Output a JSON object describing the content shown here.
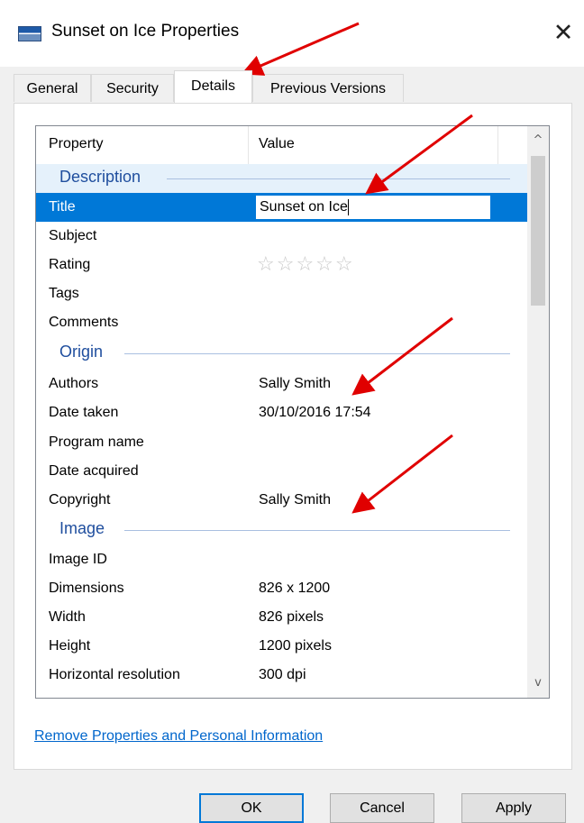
{
  "window": {
    "title": "Sunset on Ice Properties",
    "close_glyph": "✕",
    "icon": "image-file-icon"
  },
  "tabs": [
    {
      "label": "General",
      "active": false
    },
    {
      "label": "Security",
      "active": false
    },
    {
      "label": "Details",
      "active": true
    },
    {
      "label": "Previous Versions",
      "active": false
    }
  ],
  "list": {
    "columns": {
      "property": "Property",
      "value": "Value"
    },
    "groups": {
      "description": "Description",
      "origin": "Origin",
      "image": "Image"
    },
    "rows": {
      "title": {
        "key": "Title",
        "value": "Sunset on Ice"
      },
      "subject": {
        "key": "Subject",
        "value": ""
      },
      "rating": {
        "key": "Rating",
        "stars": "☆☆☆☆☆",
        "value": 0
      },
      "tags": {
        "key": "Tags",
        "value": ""
      },
      "comments": {
        "key": "Comments",
        "value": ""
      },
      "authors": {
        "key": "Authors",
        "value": "Sally Smith"
      },
      "date_taken": {
        "key": "Date taken",
        "value": "30/10/2016 17:54"
      },
      "program_name": {
        "key": "Program name",
        "value": ""
      },
      "date_acquired": {
        "key": "Date acquired",
        "value": ""
      },
      "copyright": {
        "key": "Copyright",
        "value": "Sally Smith"
      },
      "image_id": {
        "key": "Image ID",
        "value": ""
      },
      "dimensions": {
        "key": "Dimensions",
        "value": "826 x 1200"
      },
      "width": {
        "key": "Width",
        "value": "826 pixels"
      },
      "height": {
        "key": "Height",
        "value": "1200 pixels"
      },
      "horizontal_resolution": {
        "key": "Horizontal resolution",
        "value": "300 dpi"
      }
    },
    "scroll": {
      "up": "^",
      "down": "v"
    }
  },
  "link": {
    "remove": "Remove Properties and Personal Information"
  },
  "buttons": {
    "ok": "OK",
    "cancel": "Cancel",
    "apply": "Apply"
  },
  "colors": {
    "selection": "#0078d7",
    "group_text": "#1f4e9e",
    "link": "#0066cc",
    "annotation_arrow": "#e00000"
  }
}
